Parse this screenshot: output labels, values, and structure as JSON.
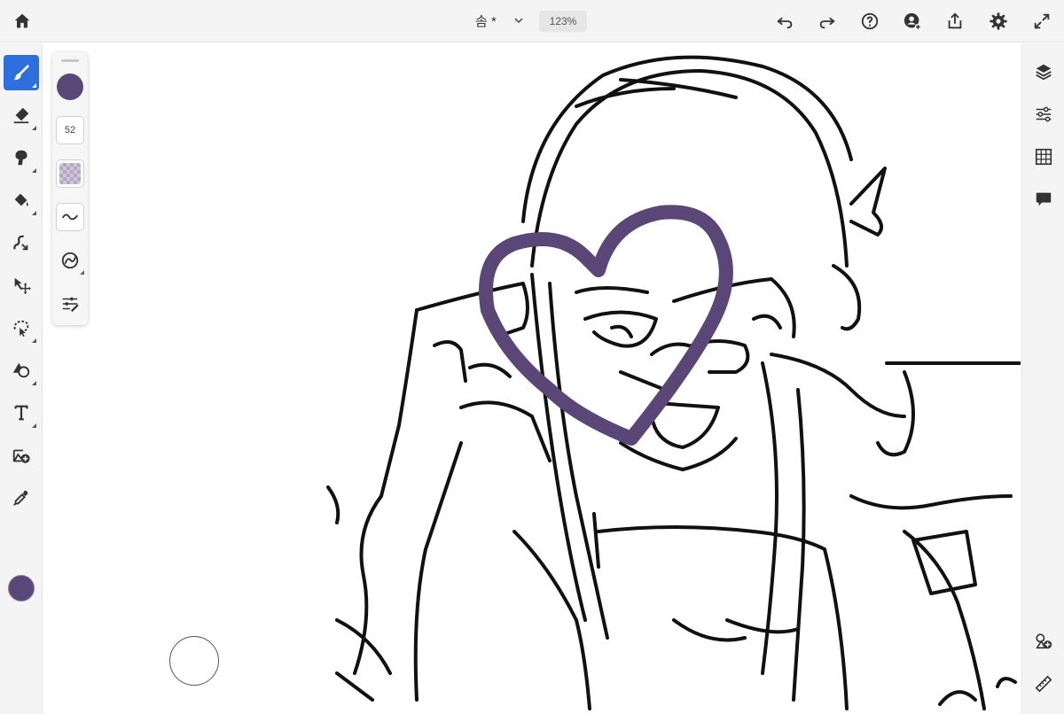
{
  "header": {
    "document_title": "솜 *",
    "zoom_level": "123%"
  },
  "icons": {
    "home": "home-icon",
    "title_menu": "chevron-down-icon",
    "undo": "undo-icon",
    "redo": "redo-icon",
    "help": "help-icon",
    "invite": "invite-user-icon",
    "share": "share-icon",
    "settings": "gear-icon",
    "fullscreen": "expand-icon"
  },
  "tools": [
    {
      "name": "brush",
      "icon": "brush-icon",
      "active": true
    },
    {
      "name": "eraser",
      "icon": "eraser-icon"
    },
    {
      "name": "smudge",
      "icon": "smudge-icon"
    },
    {
      "name": "fill",
      "icon": "paint-bucket-icon"
    },
    {
      "name": "liquify",
      "icon": "liquify-icon"
    },
    {
      "name": "transform",
      "icon": "move-icon"
    },
    {
      "name": "selection",
      "icon": "lasso-icon"
    },
    {
      "name": "shapes",
      "icon": "shapes-icon"
    },
    {
      "name": "text",
      "icon": "text-icon"
    },
    {
      "name": "place_image",
      "icon": "add-image-icon"
    },
    {
      "name": "eyedropper",
      "icon": "eyedropper-icon"
    }
  ],
  "brush_properties": {
    "color": "#5a4777",
    "size": "52",
    "flow_swatch_color": "#b3a6c2",
    "icons": [
      "smoothing-icon",
      "brush-library-icon",
      "brush-settings-icon"
    ]
  },
  "right_panel": {
    "icons": [
      "layers-icon",
      "adjustments-icon",
      "grid-icon",
      "comments-icon",
      "shapes-stencil-icon",
      "ruler-icon"
    ]
  },
  "colors": {
    "accent": "#2e6fe0",
    "current_color": "#5a4777",
    "toolbar_bg": "#f4f4f4"
  }
}
